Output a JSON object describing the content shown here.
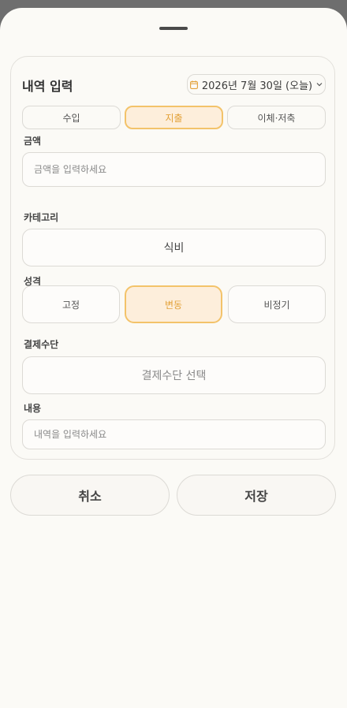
{
  "form": {
    "title": "내역 입력",
    "date_label": "2026년 7월 30일 (오늘)",
    "types": [
      "수입",
      "지출",
      "이체·저축"
    ],
    "active_type_index": 1,
    "amount": {
      "label": "금액",
      "placeholder": "금액을 입력하세요",
      "value": ""
    },
    "category": {
      "label": "카테고리",
      "value": "식비"
    },
    "nature": {
      "label": "성격",
      "options": [
        "고정",
        "변동",
        "비정기"
      ],
      "active_index": 1
    },
    "payment": {
      "label": "결제수단",
      "placeholder": "결제수단 선택"
    },
    "memo": {
      "label": "내용",
      "placeholder": "내역을 입력하세요",
      "value": ""
    }
  },
  "actions": {
    "cancel_label": "취소",
    "save_label": "저장"
  },
  "icons": {
    "date": "calendar-icon",
    "date_dropdown": "chevron-down-icon",
    "sheet_handle": "drag-handle"
  },
  "colors": {
    "accent": "#f3c36a",
    "accent_text": "#e3a23a",
    "accent_bg": "#fdeedb",
    "sheet_bg": "#fbfaf6",
    "backdrop": "#6e6e6e"
  }
}
